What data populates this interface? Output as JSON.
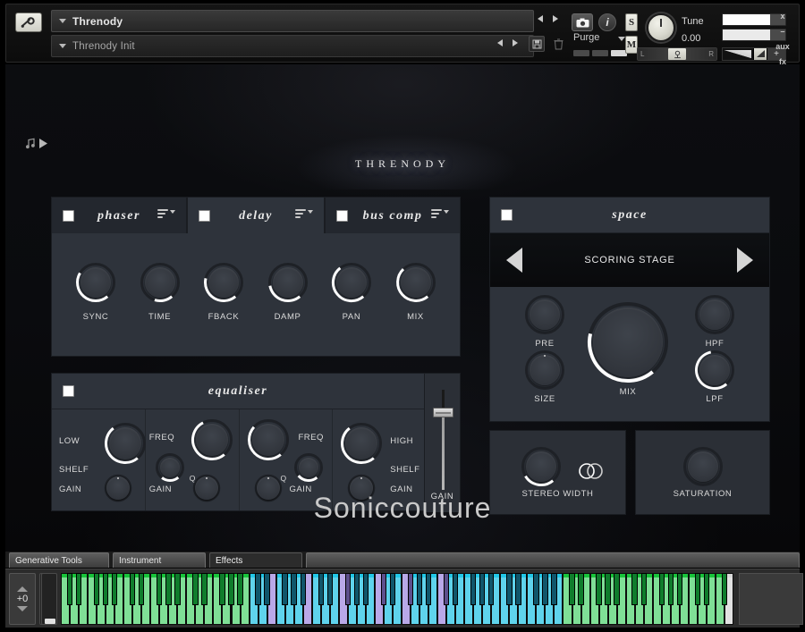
{
  "header": {
    "wrench_icon": "wrench-icon",
    "instrument_name": "Threnody",
    "preset_name": "Threnody Init",
    "camera_icon": "camera-icon",
    "info_icon": "info-icon",
    "save_icon": "save-icon",
    "trash_icon": "trash-icon",
    "purge_label": "Purge",
    "solo_label": "S",
    "mute_label": "M",
    "tune_label": "Tune",
    "tune_value": "0.00",
    "pan_left": "L",
    "pan_right": "R",
    "volume_plus": "+",
    "right_labels": [
      "x",
      "–",
      "aux",
      "fx"
    ]
  },
  "instrument": {
    "note_play_icon": "note-play-icon",
    "title": "THRENODY",
    "brand": "Soniccouture"
  },
  "fx_tabs": [
    {
      "label": "phaser",
      "active": false,
      "enabled": true
    },
    {
      "label": "delay",
      "active": true,
      "enabled": true
    },
    {
      "label": "bus comp",
      "active": false,
      "enabled": true
    }
  ],
  "delay": {
    "knobs": [
      {
        "label": "SYNC",
        "value": 0.62
      },
      {
        "label": "TIME",
        "value": 0.22
      },
      {
        "label": "FBACK",
        "value": 0.55
      },
      {
        "label": "DAMP",
        "value": 0.46
      },
      {
        "label": "PAN",
        "value": 0.7
      },
      {
        "label": "MIX",
        "value": 0.68
      }
    ]
  },
  "equaliser": {
    "title": "equaliser",
    "enabled": true,
    "bands": [
      {
        "name": "LOW",
        "name2": "SHELF",
        "freq_value": 0.7,
        "gain_label": "GAIN",
        "gain_value": 0.5
      },
      {
        "name": "FREQ",
        "q_label": "Q",
        "freq_value": 0.74,
        "q_value": 0.3,
        "gain_label": "GAIN",
        "gain_value": 0.5
      },
      {
        "name": "FREQ",
        "q_label": "Q",
        "freq_value": 0.66,
        "q_value": 0.35,
        "gain_label": "GAIN",
        "gain_value": 0.5
      },
      {
        "name": "HIGH",
        "name2": "SHELF",
        "freq_value": 0.7,
        "gain_label": "GAIN",
        "gain_value": 0.5
      }
    ],
    "fader_label": "GAIN",
    "fader_value": 0.72
  },
  "space": {
    "title": "space",
    "enabled": true,
    "preset": "SCORING STAGE",
    "prev_icon": "arrow-left-icon",
    "next_icon": "arrow-right-icon",
    "knobs": [
      {
        "label": "PRE",
        "value": 0.0
      },
      {
        "label": "SIZE",
        "value": 0.0
      },
      {
        "label": "MIX",
        "value": 0.55
      },
      {
        "label": "HPF",
        "value": 0.0
      },
      {
        "label": "LPF",
        "value": 0.8
      }
    ]
  },
  "stereo_width": {
    "label": "STEREO WIDTH",
    "value": 0.38,
    "link_icon": "stereo-link-icon"
  },
  "saturation": {
    "label": "SATURATION",
    "value": 0.0
  },
  "bottom_tabs": [
    {
      "label": "Generative Tools",
      "active": false
    },
    {
      "label": "Instrument",
      "active": false
    },
    {
      "label": "Effects",
      "active": true
    }
  ],
  "keyboard": {
    "octave_value": "+0",
    "up_icon": "arrow-up-icon",
    "down_icon": "arrow-down-icon",
    "zones": [
      {
        "color": "#7fdf96",
        "top": "#18c43a",
        "keys": 21
      },
      {
        "color": "#5fd3ec",
        "top": "#21c8e8",
        "keys": 2
      },
      {
        "color": "#b9a8e8",
        "top": "#b9a8e8",
        "keys": 1
      },
      {
        "color": "#5fd3ec",
        "top": "#21c8e8",
        "keys": 3
      },
      {
        "color": "#b9a8e8",
        "top": "#b9a8e8",
        "keys": 1
      },
      {
        "color": "#5fd3ec",
        "top": "#21c8e8",
        "keys": 3
      },
      {
        "color": "#b9a8e8",
        "top": "#b9a8e8",
        "keys": 1
      },
      {
        "color": "#5fd3ec",
        "top": "#21c8e8",
        "keys": 3
      },
      {
        "color": "#b9a8e8",
        "top": "#b9a8e8",
        "keys": 1
      },
      {
        "color": "#5fd3ec",
        "top": "#21c8e8",
        "keys": 2
      },
      {
        "color": "#b9a8e8",
        "top": "#b9a8e8",
        "keys": 1
      },
      {
        "color": "#5fd3ec",
        "top": "#21c8e8",
        "keys": 3
      },
      {
        "color": "#b9a8e8",
        "top": "#b9a8e8",
        "keys": 1
      },
      {
        "color": "#5fd3ec",
        "top": "#21c8e8",
        "keys": 13
      },
      {
        "color": "#7fdf96",
        "top": "#18c43a",
        "keys": 18
      },
      {
        "color": "#e2e2e2",
        "top": "#d8d8d8",
        "keys": 1
      }
    ]
  },
  "colors": {
    "panel": "#2e333b",
    "panel_dark": "#23272e",
    "knob_arc": "#ffffff",
    "accent_text": "#e8e8e8",
    "background": "#0a0b0e"
  }
}
